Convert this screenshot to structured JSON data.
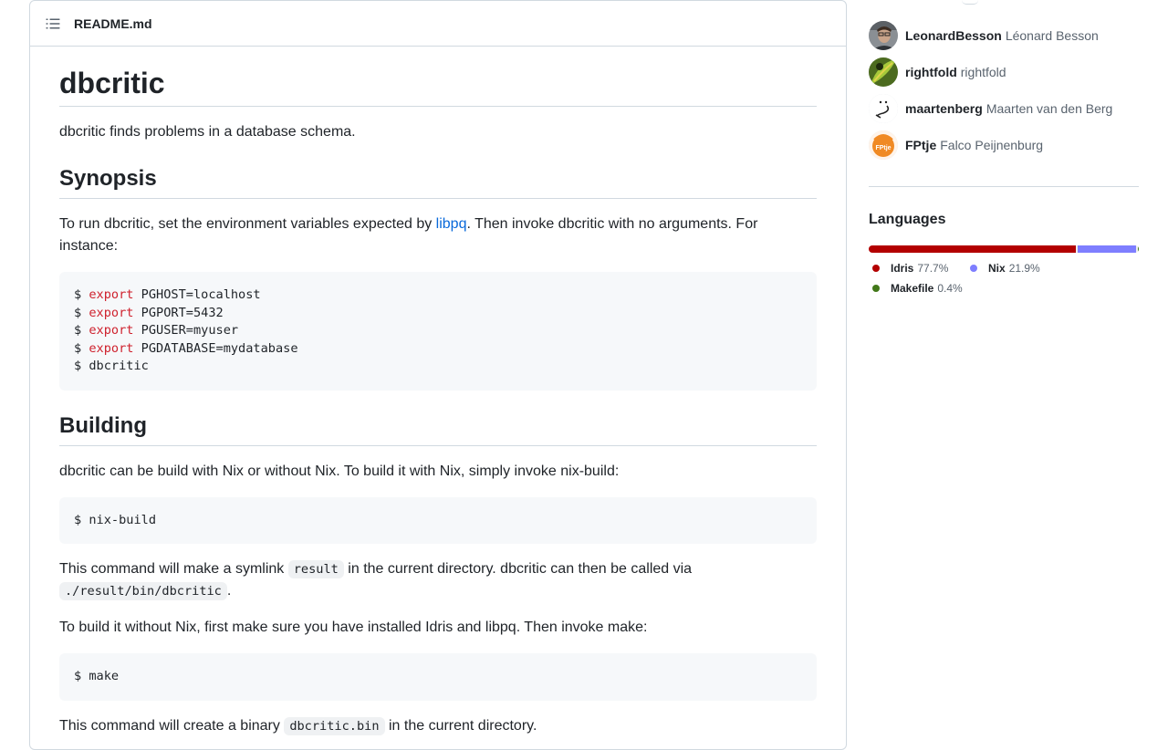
{
  "readme": {
    "file_name": "README.md",
    "title": "dbcritic",
    "intro": "dbcritic finds problems in a database schema.",
    "synopsis": {
      "heading": "Synopsis",
      "text_before": "To run dbcritic, set the environment variables expected by ",
      "link": "libpq",
      "text_after": ". Then invoke dbcritic with no arguments. For instance:",
      "code_lines": [
        {
          "prompt": "$ ",
          "keyword": "export",
          "rest": " PGHOST=localhost"
        },
        {
          "prompt": "$ ",
          "keyword": "export",
          "rest": " PGPORT=5432"
        },
        {
          "prompt": "$ ",
          "keyword": "export",
          "rest": " PGUSER=myuser"
        },
        {
          "prompt": "$ ",
          "keyword": "export",
          "rest": " PGDATABASE=mydatabase"
        },
        {
          "prompt": "$ ",
          "keyword": "",
          "rest": "dbcritic"
        }
      ]
    },
    "building": {
      "heading": "Building",
      "intro": "dbcritic can be build with Nix or without Nix. To build it with Nix, simply invoke nix-build:",
      "code_nix": "$ nix-build",
      "symlink_before": "This command will make a symlink ",
      "symlink_code": "result",
      "symlink_after": " in the current directory. dbcritic can then be called via ",
      "call_code": "./result/bin/dbcritic",
      "call_after": ".",
      "without_nix": "To build it without Nix, first make sure you have installed Idris and libpq. Then invoke make:",
      "code_make": "$ make",
      "binary_before": "This command will create a binary ",
      "binary_code": "dbcritic.bin",
      "binary_after": " in the current directory."
    }
  },
  "sidebar": {
    "contributors": [
      {
        "login": "LeonardBesson",
        "name": "Léonard Besson",
        "avatar": "person-photo-avatar"
      },
      {
        "login": "rightfold",
        "name": "rightfold",
        "avatar": "green-leaf-avatar"
      },
      {
        "login": "maartenberg",
        "name": "Maarten van den Berg",
        "avatar": "sketch-face-avatar"
      },
      {
        "login": "FPtje",
        "name": "Falco Peijnenburg",
        "avatar": "orange-fptje-avatar",
        "avatar_text": "FPtje"
      }
    ],
    "languages": {
      "title": "Languages",
      "items": [
        {
          "name": "Idris",
          "percent": "77.7%",
          "value": 77.7,
          "color": "#b30000"
        },
        {
          "name": "Nix",
          "percent": "21.9%",
          "value": 21.9,
          "color": "#7e7eff"
        },
        {
          "name": "Makefile",
          "percent": "0.4%",
          "value": 0.4,
          "color": "#427819"
        }
      ]
    }
  }
}
